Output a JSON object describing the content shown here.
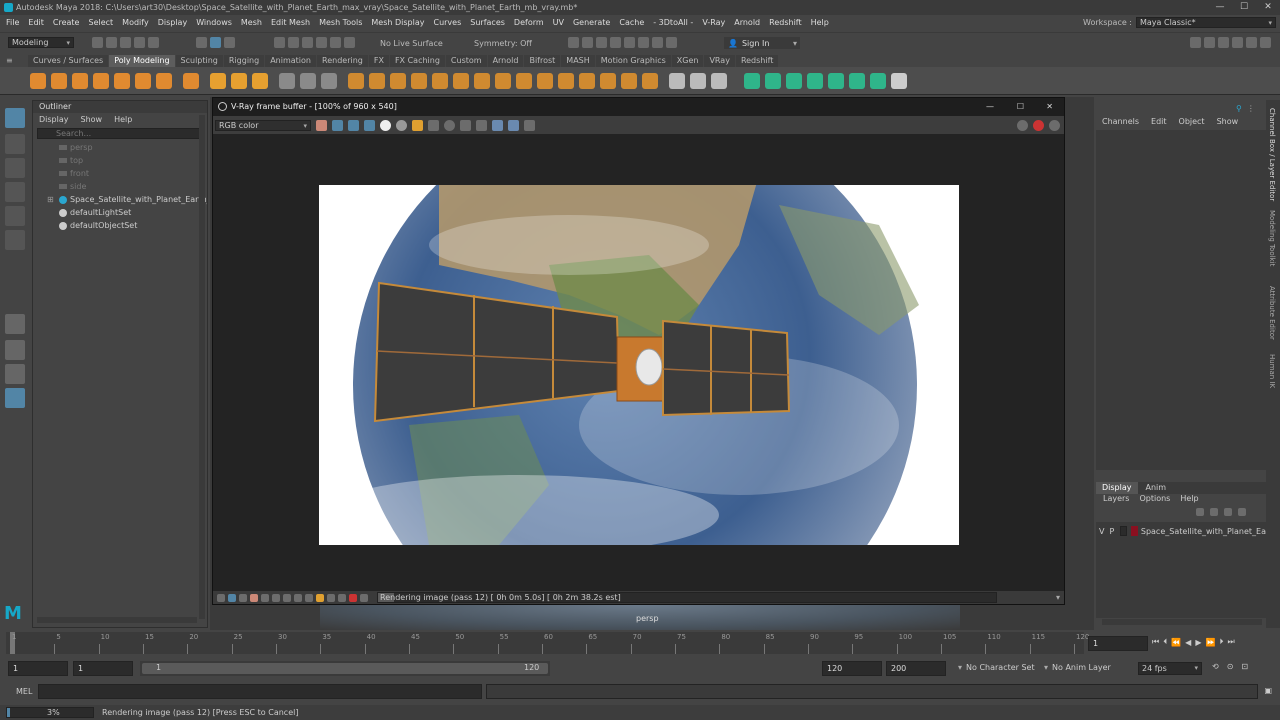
{
  "app": {
    "title": "Autodesk Maya 2018: C:\\Users\\art30\\Desktop\\Space_Satellite_with_Planet_Earth_max_vray\\Space_Satellite_with_Planet_Earth_mb_vray.mb*",
    "workspace_label": "Workspace :",
    "workspace_value": "Maya Classic*"
  },
  "menus": [
    "File",
    "Edit",
    "Create",
    "Select",
    "Modify",
    "Display",
    "Windows",
    "Mesh",
    "Edit Mesh",
    "Mesh Tools",
    "Mesh Display",
    "Curves",
    "Surfaces",
    "Deform",
    "UV",
    "Generate",
    "Cache",
    "- 3DtoAll -",
    "V-Ray",
    "Arnold",
    "Redshift",
    "Help"
  ],
  "statusline": {
    "mode": "Modeling",
    "live_surface": "No Live Surface",
    "symmetry": "Symmetry: Off",
    "sign_in": "Sign In"
  },
  "shelf_tabs": [
    {
      "label": "Curves / Surfaces",
      "active": false
    },
    {
      "label": "Poly Modeling",
      "active": true
    },
    {
      "label": "Sculpting",
      "active": false
    },
    {
      "label": "Rigging",
      "active": false
    },
    {
      "label": "Animation",
      "active": false
    },
    {
      "label": "Rendering",
      "active": false
    },
    {
      "label": "FX",
      "active": false
    },
    {
      "label": "FX Caching",
      "active": false
    },
    {
      "label": "Custom",
      "active": false
    },
    {
      "label": "Arnold",
      "active": false
    },
    {
      "label": "Bifrost",
      "active": false
    },
    {
      "label": "MASH",
      "active": false
    },
    {
      "label": "Motion Graphics",
      "active": false
    },
    {
      "label": "XGen",
      "active": false
    },
    {
      "label": "VRay",
      "active": false
    },
    {
      "label": "Redshift",
      "active": false
    }
  ],
  "outliner": {
    "title": "Outliner",
    "menu": [
      "Display",
      "Show",
      "Help"
    ],
    "search_placeholder": "Search...",
    "items": [
      {
        "label": "persp",
        "dim": true
      },
      {
        "label": "top",
        "dim": true
      },
      {
        "label": "front",
        "dim": true
      },
      {
        "label": "side",
        "dim": true
      },
      {
        "label": "Space_Satellite_with_Planet_Earth_nc",
        "dim": false
      },
      {
        "label": "defaultLightSet",
        "dim": false
      },
      {
        "label": "defaultObjectSet",
        "dim": false
      }
    ]
  },
  "vray": {
    "title": "V-Ray frame buffer - [100% of 960 x 540]",
    "channel": "RGB color",
    "status": "Rendering image (pass 12) [ 0h  0m  5.0s] [ 0h  2m 38.2s est]"
  },
  "viewport": {
    "camera_label": "persp"
  },
  "channel_box": {
    "menu": [
      "Channels",
      "Edit",
      "Object",
      "Show"
    ],
    "tabs": [
      "Display",
      "Anim"
    ],
    "layer_menu": [
      "Layers",
      "Options",
      "Help"
    ],
    "layer": {
      "v": "V",
      "p": "P",
      "name": "Space_Satellite_with_Planet_Ea",
      "color": "#8a1020"
    }
  },
  "side_tabs": [
    "Channel Box / Layer Editor",
    "Modeling Toolkit",
    "Attribute Editor",
    "Human IK"
  ],
  "timeline": {
    "ticks": [
      "1",
      "5",
      "10",
      "15",
      "20",
      "25",
      "30",
      "35",
      "40",
      "45",
      "50",
      "55",
      "60",
      "65",
      "70",
      "75",
      "80",
      "85",
      "90",
      "95",
      "100",
      "105",
      "110",
      "115",
      "120"
    ],
    "current_frame": "1"
  },
  "range": {
    "start": "1",
    "playback_start": "1",
    "slider_start": "1",
    "slider_end": "120",
    "playback_end": "120",
    "end": "200",
    "character_set": "No Character Set",
    "anim_layer": "No Anim Layer",
    "fps": "24 fps"
  },
  "cmdline": {
    "label": "MEL"
  },
  "helpline": {
    "progress": "3%",
    "progress_value": 0.03,
    "message": "Rendering image (pass 12) [Press ESC to Cancel]"
  },
  "colors": {
    "accent": "#5285a6",
    "maya_logo": "#16a8c8"
  }
}
